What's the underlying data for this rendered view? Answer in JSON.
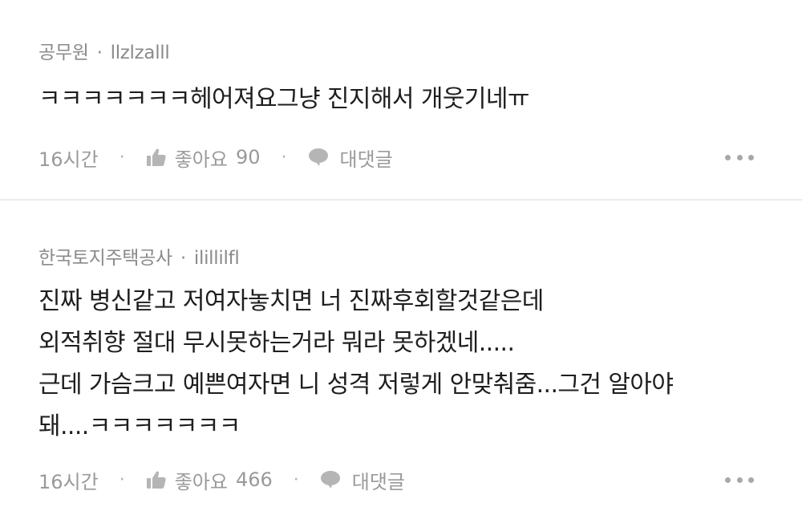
{
  "comments": [
    {
      "author": "공무원",
      "handle": "llzlzalll",
      "separator": "·",
      "text": "ㅋㅋㅋㅋㅋㅋㅋ헤어져요그냥 진지해서 개웃기네ㅠ",
      "time": "16시간",
      "like_label": "좋아요",
      "like_count": "90",
      "reply_label": "대댓글"
    },
    {
      "author": "한국토지주택공사",
      "handle": "ilillilfl",
      "separator": "·",
      "text": "진짜 병신같고 저여자놓치면 너 진짜후회할것같은데\n외적취향 절대 무시못하는거라 뭐라 못하겠네.....\n근데 가슴크고 예쁜여자면 니 성격 저렇게 안맞춰줌...그건 알아야\n돼....ㅋㅋㅋㅋㅋㅋㅋ",
      "time": "16시간",
      "like_label": "좋아요",
      "like_count": "466",
      "reply_label": "대댓글"
    }
  ],
  "footer_dot": "·",
  "icons": {
    "like": "thumbs-up-icon",
    "reply": "speech-bubble-icon",
    "more": "more-dots-icon"
  },
  "colors": {
    "meta": "#8a8a8a",
    "text": "#1e1e1e",
    "footer": "#9a9a9a",
    "divider": "#ececec"
  }
}
